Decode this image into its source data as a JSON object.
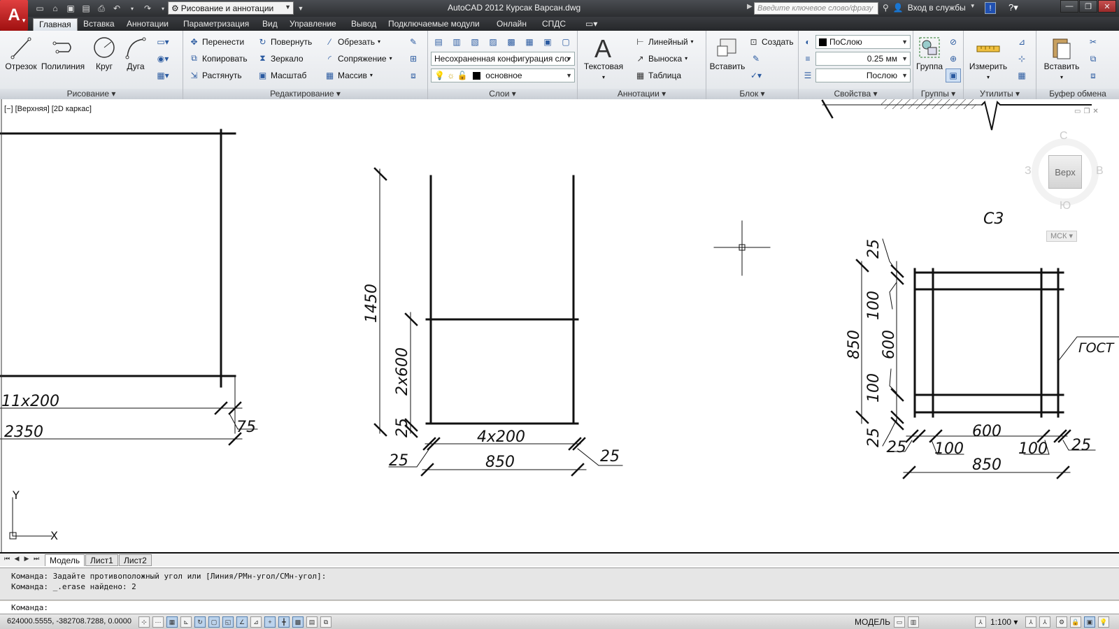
{
  "titlebar": {
    "app_letter": "A",
    "workspace": "Рисование и аннотации",
    "window_title": "AutoCAD 2012   Курсак Варсан.dwg",
    "search_placeholder": "Введите ключевое слово/фразу",
    "login": "Вход в службы"
  },
  "tabs": [
    "Главная",
    "Вставка",
    "Аннотации",
    "Параметризация",
    "Вид",
    "Управление",
    "Вывод",
    "Подключаемые модули",
    "Онлайн",
    "СПДС"
  ],
  "ribbon": {
    "draw": {
      "title": "Рисование",
      "line": "Отрезок",
      "polyline": "Полилиния",
      "circle": "Круг",
      "arc": "Дуга"
    },
    "modify": {
      "title": "Редактирование",
      "move": "Перенести",
      "rotate": "Повернуть",
      "trim": "Обрезать",
      "copy": "Копировать",
      "mirror": "Зеркало",
      "fillet": "Сопряжение",
      "stretch": "Растянуть",
      "scale": "Масштаб",
      "array": "Массив"
    },
    "layers": {
      "title": "Слои",
      "layer_state": "Несохраненная конфигурация сло",
      "current_layer": "основное"
    },
    "annotation": {
      "title": "Аннотации",
      "text": "Текстовая",
      "linear": "Линейный",
      "leader": "Выноска",
      "table": "Таблица"
    },
    "block": {
      "title": "Блок",
      "insert": "Вставить",
      "create": "Создать"
    },
    "properties": {
      "title": "Свойства",
      "color": "ПоСлою",
      "lineweight": "0.25 мм",
      "linetype": "Послою"
    },
    "groups": {
      "title": "Группы",
      "group": "Группа"
    },
    "utilities": {
      "title": "Утилиты",
      "measure": "Измерить"
    },
    "clipboard": {
      "title": "Буфер обмена",
      "paste": "Вставить"
    }
  },
  "viewport": {
    "label": "[−] [Верхняя] [2D каркас]",
    "viewcube": {
      "north": "С",
      "south": "Ю",
      "west": "З",
      "east": "В",
      "face": "Верх",
      "ucs": "МСК"
    }
  },
  "drawing_texts": {
    "left_dim_top": "11x200",
    "left_dim_bottom": "2350",
    "left_dim_offset": "75",
    "mid_height": "1450",
    "mid_spacing": "2x600",
    "mid_small_v": "25",
    "mid_width_top": "4x200",
    "mid_left_25": "25",
    "mid_width": "850",
    "mid_right_25": "25",
    "right_title": "С3",
    "right_v_top": "25",
    "right_v_100a": "100",
    "right_v_600": "600",
    "right_v_850": "850",
    "right_v_100b": "100",
    "right_v_bottom": "25",
    "right_gost": "ГОСТ",
    "right_h_600": "600",
    "right_h_25l": "25",
    "right_h_100l": "100",
    "right_h_100r": "100",
    "right_h_25r": "25",
    "right_h_850": "850",
    "ucs_x": "X",
    "ucs_y": "Y"
  },
  "layout_tabs": [
    "Модель",
    "Лист1",
    "Лист2"
  ],
  "command": {
    "line1": "Команда: Задайте противоположный угол или [Линия/РМн-угол/СМн-угол]:",
    "line2": "Команда: _.erase найдено: 2",
    "prompt": "Команда:"
  },
  "status": {
    "coords": "624000.5555, -382708.7288, 0.0000",
    "model": "МОДЕЛЬ",
    "scale": "1:100"
  }
}
